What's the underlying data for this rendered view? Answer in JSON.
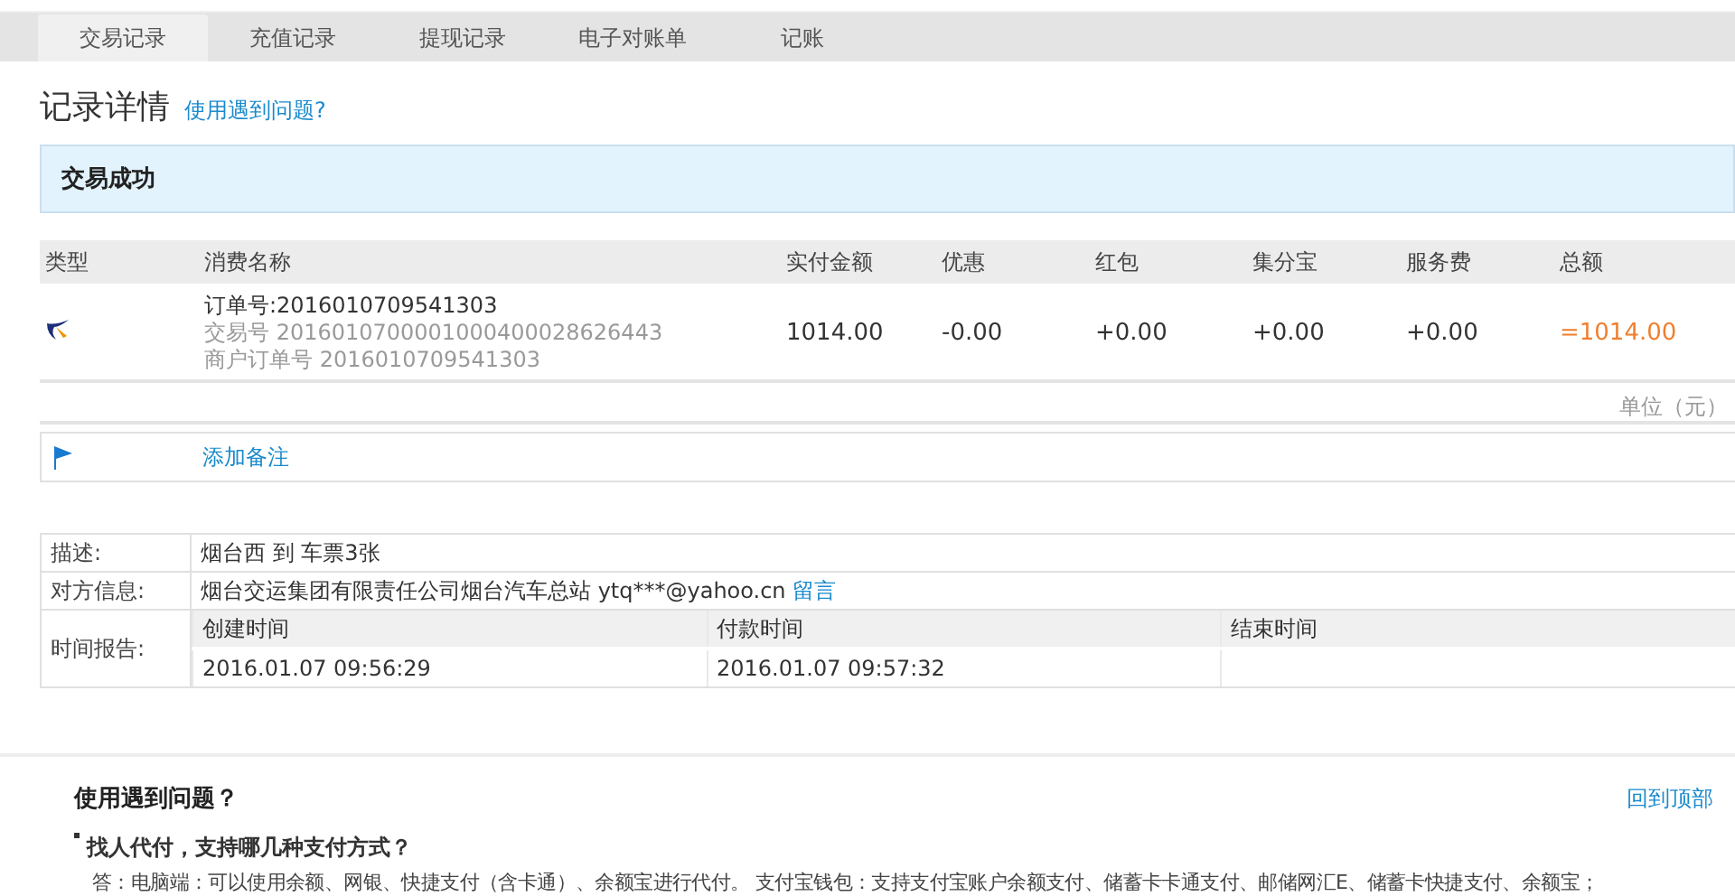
{
  "tabs": [
    {
      "label": "交易记录",
      "selected": true
    },
    {
      "label": "充值记录",
      "selected": false
    },
    {
      "label": "提现记录",
      "selected": false
    },
    {
      "label": "电子对账单",
      "selected": false
    },
    {
      "label": "记账",
      "selected": false
    }
  ],
  "heading": {
    "title": "记录详情",
    "help_link": "使用遇到问题?"
  },
  "status_banner": "交易成功",
  "table": {
    "columns": [
      "类型",
      "消费名称",
      "实付金额",
      "优惠",
      "红包",
      "集分宝",
      "服务费",
      "总额"
    ],
    "rows": [
      {
        "order_no": "订单号:2016010709541303",
        "trade_no": "交易号 2016010700001000400028626443",
        "merchant_no": "商户订单号 2016010709541303",
        "paid": "1014.00",
        "discount": "-0.00",
        "red_packet": "+0.00",
        "points": "+0.00",
        "fee": "+0.00",
        "total": "=1014.00"
      }
    ]
  },
  "unit_note": "单位（元）",
  "remark": {
    "link": "添加备注"
  },
  "info": {
    "description_label": "描述:",
    "description": "烟台西 到 车票3张",
    "counterparty_label": "对方信息:",
    "counterparty": "烟台交运集团有限责任公司烟台汽车总站 ytq***@yahoo.cn",
    "message_link": "留言",
    "time_label": "时间报告:",
    "time_columns": [
      "创建时间",
      "付款时间",
      "结束时间"
    ],
    "time_values": [
      "2016.01.07 09:56:29",
      "2016.01.07 09:57:32"
    ]
  },
  "help": {
    "title": "使用遇到问题？",
    "back_to_top": "回到顶部",
    "question": "找人代付，支持哪几种支付方式？",
    "answer": "答：电脑端：可以使用余额、网银、快捷支付（含卡通）、余额宝进行代付。 支付宝钱包：支持支付宝账户余额支付、储蓄卡卡通支付、邮储网汇E、储蓄卡快捷支付、余额宝；"
  }
}
